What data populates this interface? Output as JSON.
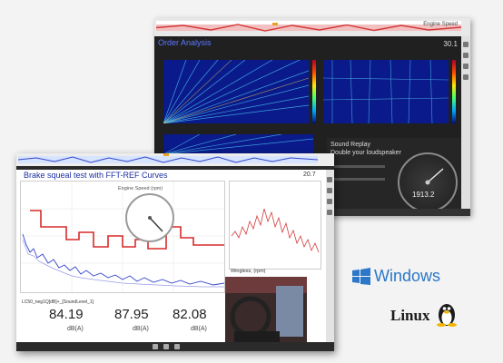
{
  "back_window": {
    "title": "Order Analysis",
    "speed_value": "30.1",
    "sound_title": "Sound Replay",
    "sound_subtitle": "Double your loudspeaker",
    "gauge_value": "1913.2"
  },
  "front_window": {
    "title": "Brake squeal test with FFT-REF Curves",
    "speed_value": "20.7",
    "engine_speed_label": "Engine Speed (rpm)",
    "mini_chart_label": "Wingless, (rpm)",
    "legend_item": "LC50_neg1Q[dB]+_[SoundLevel_1]",
    "values": [
      {
        "value": "84.19",
        "unit": "dB(A)"
      },
      {
        "value": "87.95",
        "unit": "dB(A)"
      },
      {
        "value": "82.08",
        "unit": "dB(A)"
      }
    ]
  },
  "platforms": {
    "windows": "Windows",
    "linux": "Linux"
  },
  "colors": {
    "accent_blue": "#2c77c8",
    "wave_red": "#d33a3a",
    "curve_blue": "#3344cc"
  }
}
